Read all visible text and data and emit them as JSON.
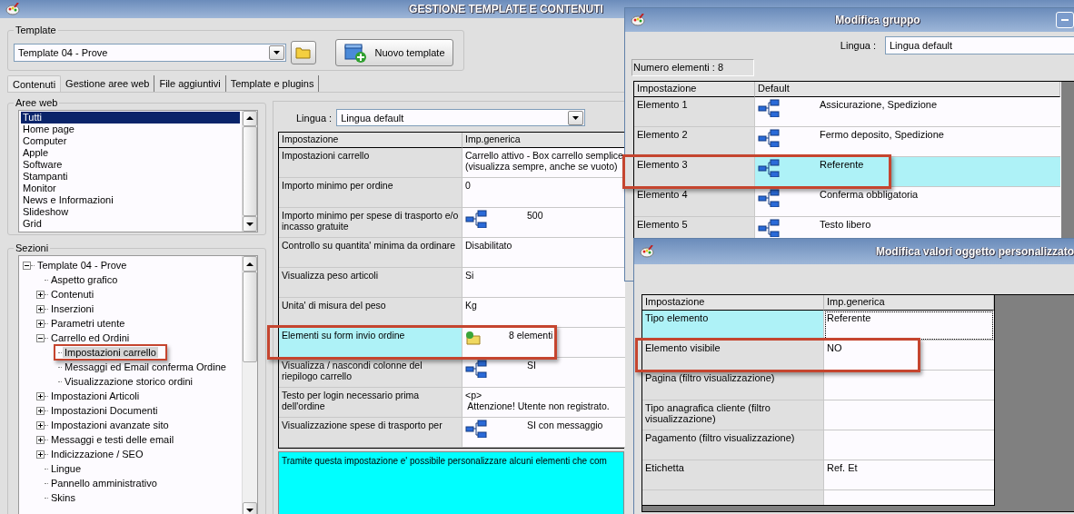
{
  "main_window": {
    "title": "GESTIONE TEMPLATE E CONTENUTI"
  },
  "template_group": {
    "label": "Template",
    "value": "Template 04 - Prove",
    "new_button": "Nuovo template"
  },
  "tabs": [
    {
      "label": "Contenuti",
      "selected": true
    },
    {
      "label": "Gestione aree web",
      "selected": false
    },
    {
      "label": "File aggiuntivi",
      "selected": false
    },
    {
      "label": "Template e plugins",
      "selected": false
    }
  ],
  "web_areas": {
    "label": "Aree web",
    "items": [
      {
        "label": "Tutti",
        "selected": true
      },
      {
        "label": "Home page",
        "selected": false
      },
      {
        "label": "Computer",
        "selected": false
      },
      {
        "label": "Apple",
        "selected": false
      },
      {
        "label": "Software",
        "selected": false
      },
      {
        "label": "Stampanti",
        "selected": false
      },
      {
        "label": "Monitor",
        "selected": false
      },
      {
        "label": "News e Informazioni",
        "selected": false
      },
      {
        "label": "Slideshow",
        "selected": false
      },
      {
        "label": "Grid",
        "selected": false
      }
    ]
  },
  "sections": {
    "label": "Sezioni",
    "tree": [
      {
        "label": "Template 04 - Prove",
        "kind": "group",
        "expanded": true,
        "selected": false,
        "callout": false,
        "children": [
          {
            "label": "Aspetto grafico",
            "kind": "leaf",
            "selected": false,
            "callout": false
          },
          {
            "label": "Contenuti",
            "kind": "group",
            "expanded": false,
            "selected": false,
            "callout": false
          },
          {
            "label": "Inserzioni",
            "kind": "group",
            "expanded": false,
            "selected": false,
            "callout": false
          },
          {
            "label": "Parametri utente",
            "kind": "group",
            "expanded": false,
            "selected": false,
            "callout": false
          },
          {
            "label": "Carrello ed Ordini",
            "kind": "group",
            "expanded": true,
            "selected": false,
            "callout": false,
            "children": [
              {
                "label": "Impostazioni carrello",
                "kind": "leaf",
                "selected": true,
                "callout": true
              },
              {
                "label": "Messaggi ed Email conferma Ordine",
                "kind": "leaf",
                "selected": false,
                "callout": false
              },
              {
                "label": "Visualizzazione storico ordini",
                "kind": "leaf",
                "selected": false,
                "callout": false
              }
            ]
          },
          {
            "label": "Impostazioni Articoli",
            "kind": "group",
            "expanded": false,
            "selected": false,
            "callout": false
          },
          {
            "label": "Impostazioni Documenti",
            "kind": "group",
            "expanded": false,
            "selected": false,
            "callout": false
          },
          {
            "label": "Impostazioni avanzate sito",
            "kind": "group",
            "expanded": false,
            "selected": false,
            "callout": false
          },
          {
            "label": "Messaggi e testi delle email",
            "kind": "group",
            "expanded": false,
            "selected": false,
            "callout": false
          },
          {
            "label": "Indicizzazione / SEO",
            "kind": "group",
            "expanded": false,
            "selected": false,
            "callout": false
          },
          {
            "label": "Lingue",
            "kind": "leaf",
            "selected": false,
            "callout": false
          },
          {
            "label": "Pannello amministrativo",
            "kind": "leaf",
            "selected": false,
            "callout": false
          },
          {
            "label": "Skins",
            "kind": "leaf",
            "selected": false,
            "callout": false
          }
        ]
      }
    ]
  },
  "settings": {
    "language_label": "Lingua :",
    "language": "Lingua default",
    "columns": [
      "Impostazione",
      "Imp.generica"
    ],
    "rows": [
      {
        "setting": "Impostazioni carrello",
        "value": "Carrello attivo - Box carrello semplice\n(visualizza sempre, anche se vuoto)",
        "kind": "text",
        "selected": false,
        "callout": false
      },
      {
        "setting": "Importo minimo per ordine",
        "value": "0",
        "kind": "text",
        "selected": false,
        "callout": false
      },
      {
        "setting": "Importo minimo per spese di trasporto e/o incasso gratuite",
        "value": "500",
        "kind": "hierarchy",
        "selected": false,
        "callout": false
      },
      {
        "setting": "Controllo su quantita' minima da ordinare",
        "value": "Disabilitato",
        "kind": "text",
        "selected": false,
        "callout": false
      },
      {
        "setting": "Visualizza peso articoli",
        "value": "Si",
        "kind": "text",
        "selected": false,
        "callout": false
      },
      {
        "setting": "Unita' di misura del peso",
        "value": "Kg",
        "kind": "text",
        "selected": false,
        "callout": false
      },
      {
        "setting": "Elementi su form invio ordine",
        "value": "8 elementi",
        "kind": "folder",
        "selected": true,
        "callout": true
      },
      {
        "setting": "Visualizza / nascondi colonne del riepilogo carrello",
        "value": "SI",
        "kind": "hierarchy",
        "selected": false,
        "callout": false
      },
      {
        "setting": "Testo per login necessario prima dell'ordine",
        "value": "<p>\n Attenzione! Utente non registrato.",
        "kind": "text",
        "selected": false,
        "callout": false
      },
      {
        "setting": "Visualizzazione spese di trasporto per",
        "value": "SI con messaggio",
        "kind": "hierarchy",
        "selected": false,
        "callout": false
      }
    ],
    "description": "Tramite questa impostazione e' possibile personalizzare alcuni elementi che com"
  },
  "group_window": {
    "title": "Modifica gruppo",
    "language_label": "Lingua :",
    "language": "Lingua default",
    "count": "Numero elementi : 8",
    "columns": [
      "Impostazione",
      "Default"
    ],
    "rows": [
      {
        "setting": "Elemento 1",
        "value": "Assicurazione, Spedizione",
        "kind": "hierarchy",
        "selected": false,
        "callout": false
      },
      {
        "setting": "Elemento 2",
        "value": "Fermo deposito, Spedizione",
        "kind": "hierarchy",
        "selected": false,
        "callout": false
      },
      {
        "setting": "Elemento 3",
        "value": "Referente",
        "kind": "hierarchy",
        "selected": true,
        "callout": true
      },
      {
        "setting": "Elemento 4",
        "value": "Conferma obbligatoria",
        "kind": "hierarchy",
        "selected": false,
        "callout": false
      },
      {
        "setting": "Elemento 5",
        "value": "Testo libero",
        "kind": "hierarchy",
        "selected": false,
        "callout": false
      }
    ]
  },
  "object_window": {
    "title": "Modifica valori oggetto personalizzato",
    "columns": [
      "Impostazione",
      "Imp.generica"
    ],
    "rows": [
      {
        "setting": "Tipo elemento",
        "value": "Referente",
        "kind": "text",
        "selected": true,
        "callout": false
      },
      {
        "setting": "Elemento visibile",
        "value": "NO",
        "kind": "text",
        "selected": false,
        "callout": true
      },
      {
        "setting": "Pagina (filtro visualizzazione)",
        "kind": "text",
        "selected": false,
        "callout": false
      },
      {
        "setting": "Tipo anagrafica cliente (filtro visualizzazione)",
        "kind": "text",
        "selected": false,
        "callout": false
      },
      {
        "setting": "Pagamento (filtro visualizzazione)",
        "kind": "text",
        "selected": false,
        "callout": false
      },
      {
        "setting": "Etichetta",
        "value": "Ref. Et",
        "kind": "text",
        "selected": false,
        "callout": false
      }
    ]
  }
}
